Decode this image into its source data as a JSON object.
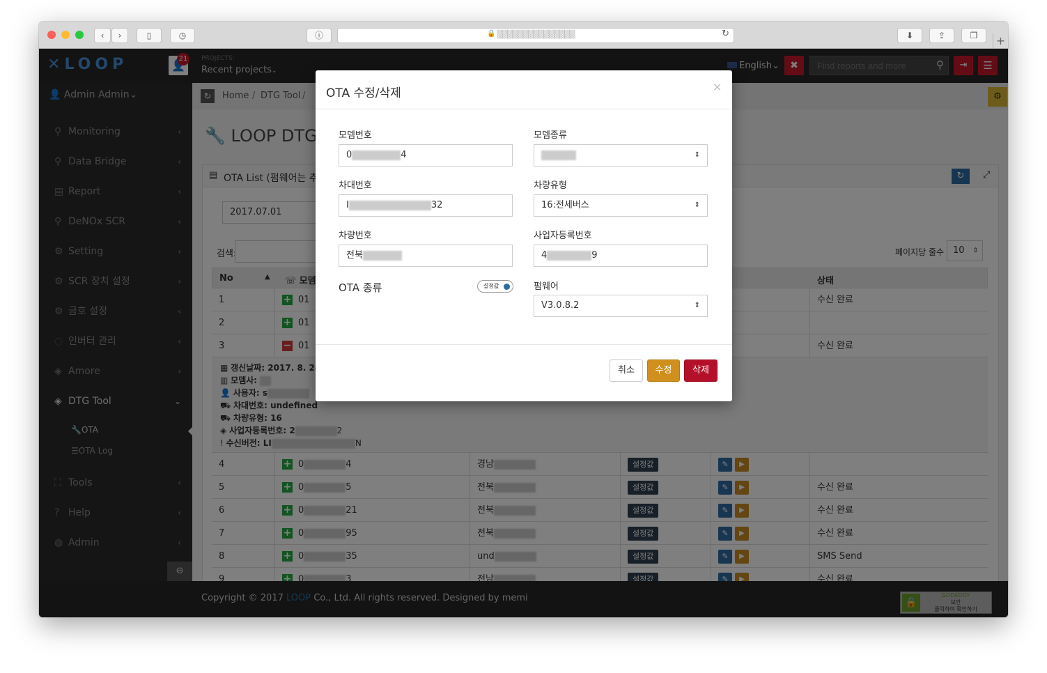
{
  "browser": {
    "url_text": "▒▒▒▒▒▒▒▒▒▒▒▒▒▒▒"
  },
  "topbar": {
    "logo": "LOOP",
    "notification_count": "21",
    "projects_label": "PROJECTS:",
    "projects_value": "Recent projects",
    "language": "English",
    "search_placeholder": "Find reports and more"
  },
  "sidebar": {
    "user": "Admin Admin",
    "items": [
      {
        "label": "Monitoring"
      },
      {
        "label": "Data Bridge"
      },
      {
        "label": "Report"
      },
      {
        "label": "DeNOx SCR"
      },
      {
        "label": "Setting"
      },
      {
        "label": "SCR 장치 설정"
      },
      {
        "label": "금호 설정"
      },
      {
        "label": "인버터 관리"
      },
      {
        "label": "Amore"
      },
      {
        "label": "DTG Tool"
      },
      {
        "label": "Tools"
      },
      {
        "label": "Help"
      },
      {
        "label": "Admin"
      }
    ],
    "sub_items": [
      {
        "label": "OTA"
      },
      {
        "label": "OTA Log"
      }
    ]
  },
  "main": {
    "breadcrumb": [
      "Home",
      "DTG Tool"
    ],
    "page_title": "LOOP DTG Fi",
    "panel_title": "OTA List (펌웨어는 추후",
    "date_value": "2017.07.01",
    "search_label": "검색:",
    "page_size_label": "페이지당 줄수",
    "page_size_value": "10",
    "columns": {
      "no": "No",
      "modem": "모뎀번",
      "status": "상태"
    },
    "rows": [
      {
        "no": "1",
        "modem": "01",
        "status": "수신 완료"
      },
      {
        "no": "2",
        "modem": "01",
        "status": ""
      },
      {
        "no": "3",
        "modem": "01",
        "status": "수신 완료"
      }
    ],
    "detail": {
      "updated": "갱신날짜: 2017. 8. 24",
      "maker": "모뎀사:",
      "user": "사용자: s",
      "car_no": "차대번호: undefined",
      "car_type": "차량유형: 16",
      "biz_no": "사업자등록번호: 2",
      "biz_no_end": "2",
      "recv_ver": "수신버전: LI",
      "recv_ver_end": "N"
    },
    "rows2": [
      {
        "no": "4",
        "modem": "0",
        "modem_end": "4",
        "plate": "경남",
        "setting": "설정값",
        "status": ""
      },
      {
        "no": "5",
        "modem": "0",
        "modem_end": "5",
        "plate": "전북",
        "setting": "설정값",
        "status": "수신 완료"
      },
      {
        "no": "6",
        "modem": "0",
        "modem_end": "21",
        "plate": "전북",
        "setting": "설정값",
        "status": "수신 완료"
      },
      {
        "no": "7",
        "modem": "0",
        "modem_end": "95",
        "plate": "전북",
        "setting": "설정값",
        "status": "수신 완료"
      },
      {
        "no": "8",
        "modem": "0",
        "modem_end": "35",
        "plate": "und",
        "setting": "설정값",
        "status": "SMS Send"
      },
      {
        "no": "9",
        "modem": "0",
        "modem_end": "3",
        "plate": "전남",
        "setting": "설정값",
        "status": "수신 완료"
      }
    ]
  },
  "footer": {
    "copyright_pre": "Copyright © 2017",
    "brand": "LOOP",
    "copyright_post": "Co., Ltd. All rights reserved. Designed by  memi",
    "seal_line1": "GODADDY",
    "seal_line2": "보안",
    "seal_line3": "클릭하여 확인하기"
  },
  "modal": {
    "title": "OTA 수정/삭제",
    "close": "×",
    "modem_no_label": "모뎀번호",
    "modem_no_value": "0",
    "modem_no_end": "4",
    "modem_type_label": "모뎀종류",
    "car_no_label": "차대번호",
    "car_no_value": "I",
    "car_no_end": "32",
    "car_type_label": "차량유형",
    "car_type_value": "16:전세버스",
    "plate_label": "차량번호",
    "plate_value": "전북",
    "biz_label": "사업자등록번호",
    "biz_value": "4",
    "biz_end": "9",
    "ota_type_label": "OTA 종류",
    "toggle_text": "설정값",
    "firmware_label": "펌웨어",
    "firmware_value": "V3.0.8.2",
    "cancel": "취소",
    "edit": "수정",
    "delete": "삭제"
  },
  "colors": {
    "accent_red": "#c9182b",
    "edit_orange": "#d1901d",
    "loop_blue": "#4a90d9"
  }
}
